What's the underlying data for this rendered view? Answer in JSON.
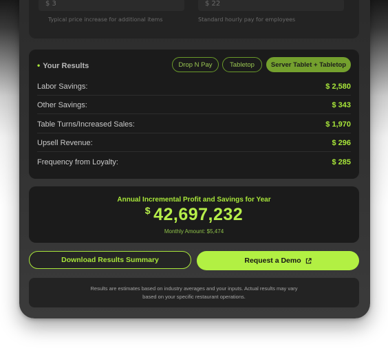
{
  "top_section": {
    "input_left_value": "$ 3",
    "input_right_value": "$ 22",
    "hint_left": "Typical price increase for additional items",
    "hint_right": "Standard hourly pay for employees"
  },
  "results": {
    "title": "Your Results",
    "tabs": [
      {
        "label": "Drop N Pay",
        "active": false
      },
      {
        "label": "Tabletop",
        "active": false
      },
      {
        "label": "Server Tablet + Tabletop",
        "active": true
      }
    ],
    "rows": [
      {
        "label": "Labor Savings:",
        "value": "$ 2,580"
      },
      {
        "label": "Other Savings:",
        "value": "$ 343"
      },
      {
        "label": "Table Turns/Increased Sales:",
        "value": "$ 1,970"
      },
      {
        "label": "Upsell Revenue:",
        "value": "$ 296"
      },
      {
        "label": "Frequency from Loyalty:",
        "value": "$ 285"
      }
    ]
  },
  "annual": {
    "title": "Annual Incremental Profit and Savings for Year",
    "currency": "$",
    "amount": "42,697,232",
    "monthly": "Monthly Amount: $5,474"
  },
  "actions": {
    "download_label": "Download Results Summary",
    "demo_label": "Request a Demo"
  },
  "disclaimer": "Results are estimates based on industry averages and your inputs. Actual results may vary based on your specific restaurant operations.",
  "colors": {
    "accent": "#a8e63a",
    "panel": "#1b1b1b",
    "device": "#2f2f2f"
  }
}
